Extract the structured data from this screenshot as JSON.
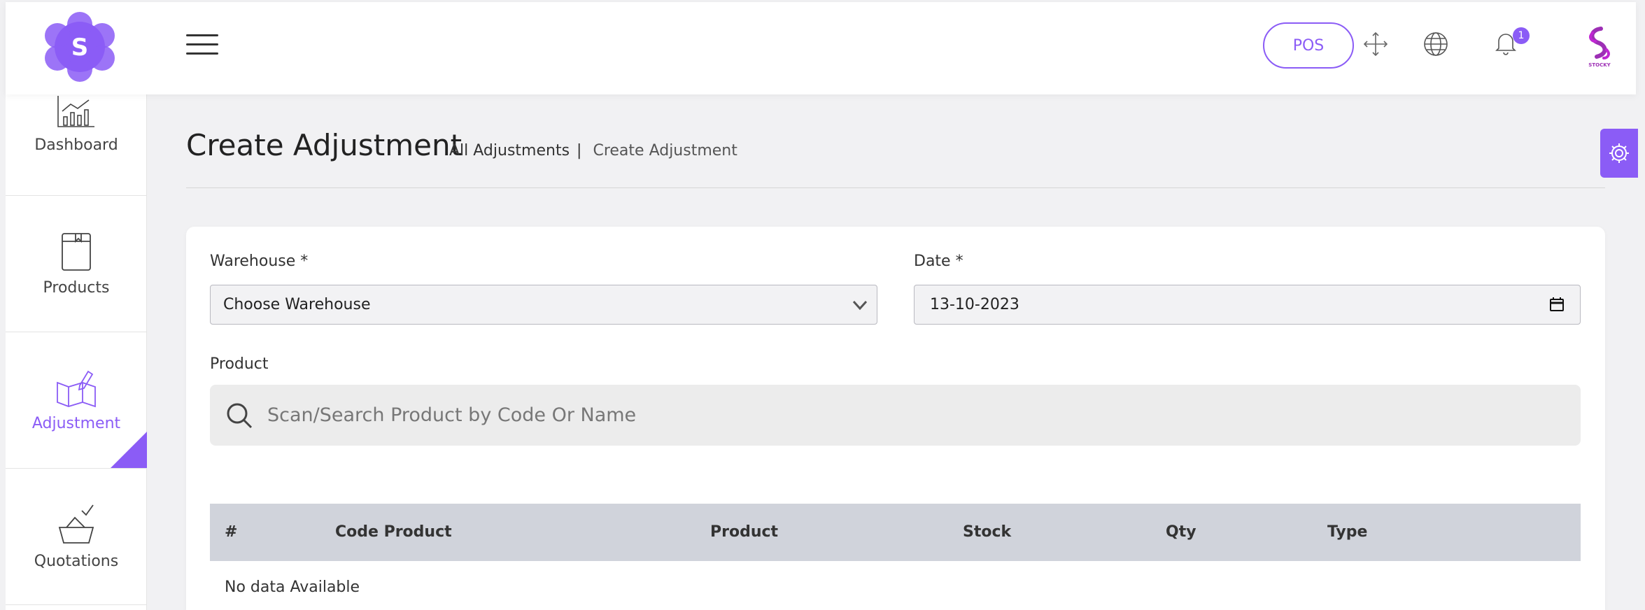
{
  "header": {
    "logo_letter": "S",
    "pos_label": "POS",
    "notification_count": "1",
    "brand_text": "STOCKY",
    "accent_color": "#8b5cf6",
    "icons": [
      "menu-icon",
      "fullscreen-icon",
      "globe-icon",
      "bell-icon"
    ]
  },
  "sidebar": {
    "items": [
      {
        "label": "Dashboard",
        "icon": "dashboard-chart-icon"
      },
      {
        "label": "Products",
        "icon": "product-book-icon"
      },
      {
        "label": "Adjustment",
        "icon": "adjustment-map-icon",
        "active": true
      },
      {
        "label": "Quotations",
        "icon": "quotation-basket-icon"
      }
    ]
  },
  "page": {
    "title": "Create Adjustment",
    "breadcrumb_parent": "All Adjustments",
    "breadcrumb_sep": "|",
    "breadcrumb_current": "Create Adjustment"
  },
  "form": {
    "warehouse_label": "Warehouse *",
    "warehouse_value": "Choose Warehouse",
    "date_label": "Date *",
    "date_value": "13-10-2023",
    "product_label": "Product",
    "search_placeholder": "Scan/Search Product by Code Or Name"
  },
  "table": {
    "columns": [
      "#",
      "Code Product",
      "Product",
      "Stock",
      "Qty",
      "Type"
    ],
    "empty_text": "No data Available"
  }
}
